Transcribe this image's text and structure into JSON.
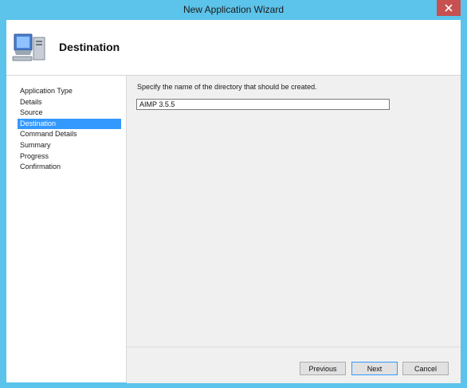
{
  "window": {
    "title": "New Application Wizard"
  },
  "header": {
    "title": "Destination",
    "icon": "computer-icon"
  },
  "nav": {
    "items": [
      {
        "label": "Application Type"
      },
      {
        "label": "Details"
      },
      {
        "label": "Source"
      },
      {
        "label": "Destination",
        "active": true
      },
      {
        "label": "Command Details"
      },
      {
        "label": "Summary"
      },
      {
        "label": "Progress"
      },
      {
        "label": "Confirmation"
      }
    ]
  },
  "content": {
    "instruction": "Specify the name of the directory that should be created.",
    "directory_value": "AIMP 3.5.5"
  },
  "footer": {
    "previous_label": "Previous",
    "next_label": "Next",
    "cancel_label": "Cancel"
  },
  "colors": {
    "frame": "#5cc3ea",
    "selection": "#3399ff",
    "close": "#c75050"
  }
}
